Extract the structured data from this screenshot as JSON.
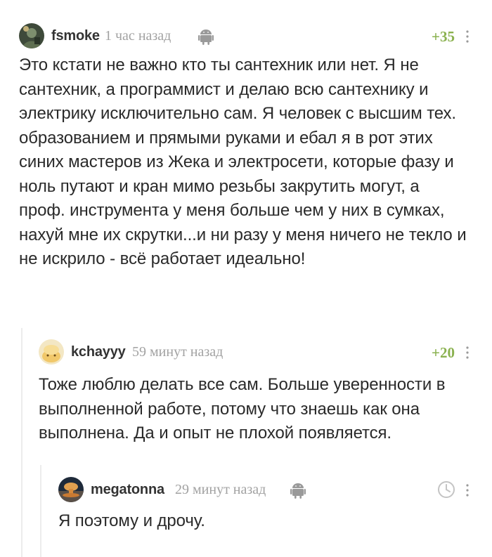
{
  "comments": [
    {
      "author": "fsmoke",
      "time": "1 час назад",
      "rating": "+35",
      "text": "Это кстати не важно кто ты сантехник или нет. Я не сантехник, а программист и делаю всю сантехнику и электрику исключительно сам. Я человек с высшим тех. образованием и прямыми руками и ебал я в рот этих синих мастеров из Жека и электросети, которые фазу и ноль путают и кран мимо резьбы закрутить могут, а проф. инструмента у меня больше чем у них в сумках, нахуй мне их скрутки...и ни разу у меня ничего не текло и не искрило - всё работает идеально!",
      "avatar_icon": "avatar-photo-icon"
    },
    {
      "author": "kchayyy",
      "time": "59 минут назад",
      "rating": "+20",
      "text": "Тоже люблю делать все сам. Больше уверенности в выполненной работе, потому что знаешь как она выполнена. Да и опыт не плохой появляется.",
      "avatar_icon": "avatar-photo-icon"
    },
    {
      "author": "megatonna",
      "time": "29 минут назад",
      "text": "Я поэтому и дрочу.",
      "avatar_icon": "avatar-photo-icon"
    }
  ],
  "colors": {
    "rating": "#8ab14f",
    "meta": "#a2a2a2",
    "thread_line": "#ececec"
  },
  "icons": {
    "platform": "android-icon",
    "menu": "more-vertical-icon",
    "pending": "clock-icon"
  }
}
